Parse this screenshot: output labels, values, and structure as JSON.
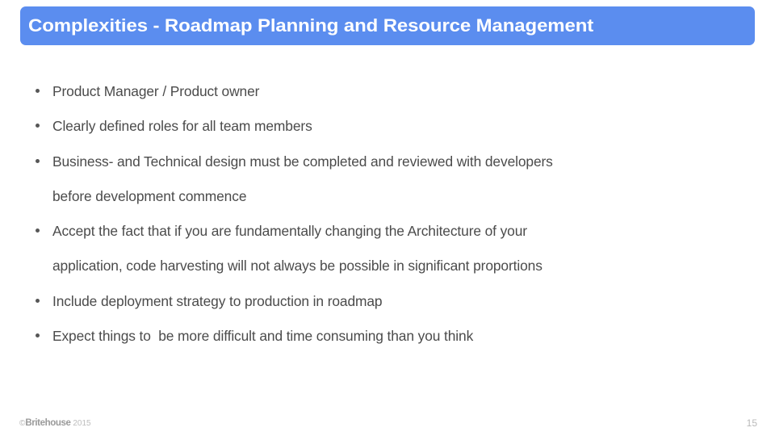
{
  "slide": {
    "title": "Complexities - Roadmap Planning and Resource Management",
    "title_bar_color": "#5b8def",
    "title_text_color": "#ffffff",
    "background_color": "#ffffff",
    "body_text_color": "#4b4b4b"
  },
  "bullets": [
    {
      "lines": [
        "Product Manager / Product owner"
      ]
    },
    {
      "lines": [
        "Clearly defined roles for all team members"
      ]
    },
    {
      "lines": [
        "Business- and Technical design must be completed and reviewed with developers",
        "before development commence"
      ]
    },
    {
      "lines": [
        "Accept the fact that if you are fundamentally changing the Architecture of your",
        "application, code harvesting will not always be possible in significant proportions"
      ]
    },
    {
      "lines": [
        "Include deployment strategy to production in roadmap"
      ]
    },
    {
      "lines": [
        "Expect things to  be more difficult and time consuming than you think"
      ]
    }
  ],
  "footer": {
    "copyright_symbol": "©",
    "brand": "Britehouse",
    "year": "2015",
    "page_number": "15"
  }
}
